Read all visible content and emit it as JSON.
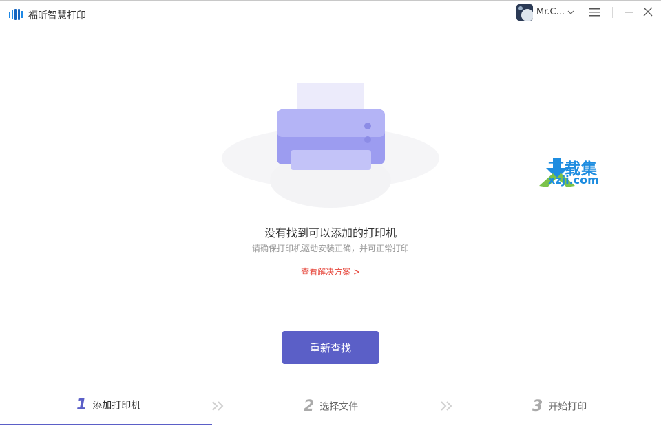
{
  "app": {
    "title": "福昕智慧打印"
  },
  "user": {
    "name": "Mr.C..."
  },
  "empty_state": {
    "title": "没有找到可以添加的打印机",
    "subtitle": "请确保打印机驱动安装正确，并可正常打印",
    "solution_link": "查看解决方案 >"
  },
  "retry_button": {
    "label": "重新查找"
  },
  "steps": [
    {
      "number": "1",
      "label": "添加打印机",
      "active": true
    },
    {
      "number": "2",
      "label": "选择文件",
      "active": false
    },
    {
      "number": "3",
      "label": "开始打印",
      "active": false
    }
  ],
  "watermark": {
    "cn": "下载集",
    "en": "xzji.com"
  },
  "colors": {
    "accent": "#5b5fc7",
    "link": "#e6453a",
    "watermark": "#1e8de0"
  }
}
